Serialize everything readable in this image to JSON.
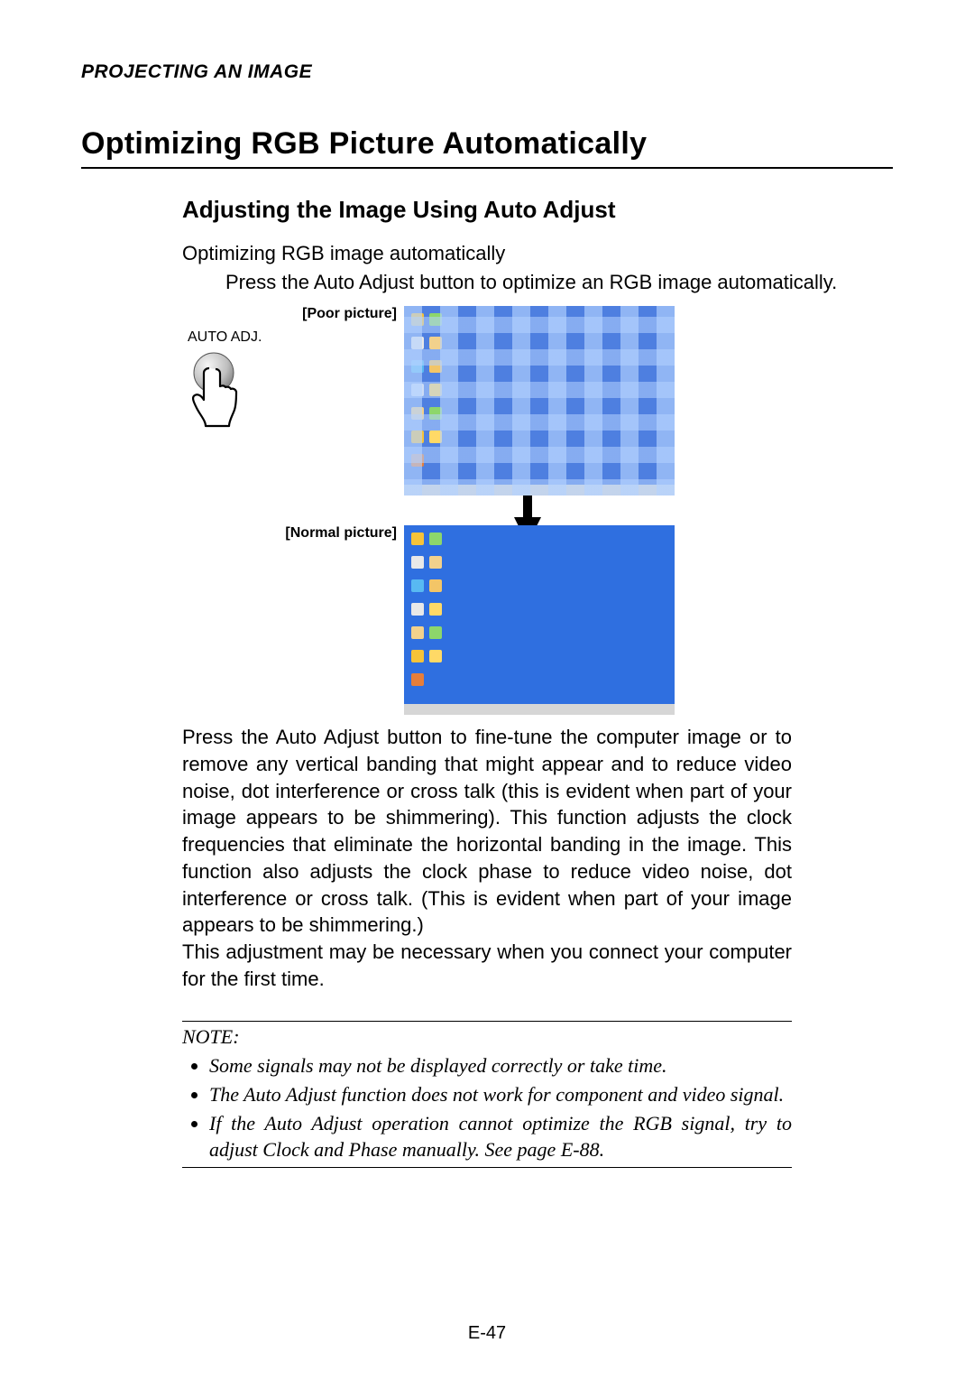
{
  "header": "PROJECTING AN IMAGE",
  "title": "Optimizing RGB Picture Automatically",
  "subtitle": "Adjusting the Image Using Auto Adjust",
  "intro_line": "Optimizing RGB image automatically",
  "intro_sub": "Press the Auto Adjust button to optimize an RGB image automatically.",
  "figure": {
    "poor_label": "[Poor picture]",
    "normal_label": "[Normal picture]",
    "button_label": "AUTO ADJ."
  },
  "para1": "Press the Auto Adjust button to fine-tune the computer image or to remove any vertical banding that might appear and to reduce video noise, dot interference or cross talk (this is evident when part of your image appears to be shimmering). This function adjusts the clock frequencies that eliminate the horizontal banding in the image. This function also adjusts the clock phase to reduce video noise, dot interference or cross talk. (This is evident when part of your image appears to be shimmering.)",
  "para2": "This adjustment may be necessary when you connect your computer for the first time.",
  "note": {
    "label": "NOTE:",
    "items": [
      "Some signals may not be displayed correctly or take time.",
      "The Auto Adjust function does not work for component and video signal.",
      "If the Auto Adjust operation cannot optimize the RGB signal, try to adjust Clock and Phase manually. See page E-88."
    ]
  },
  "page_number": "E-47"
}
